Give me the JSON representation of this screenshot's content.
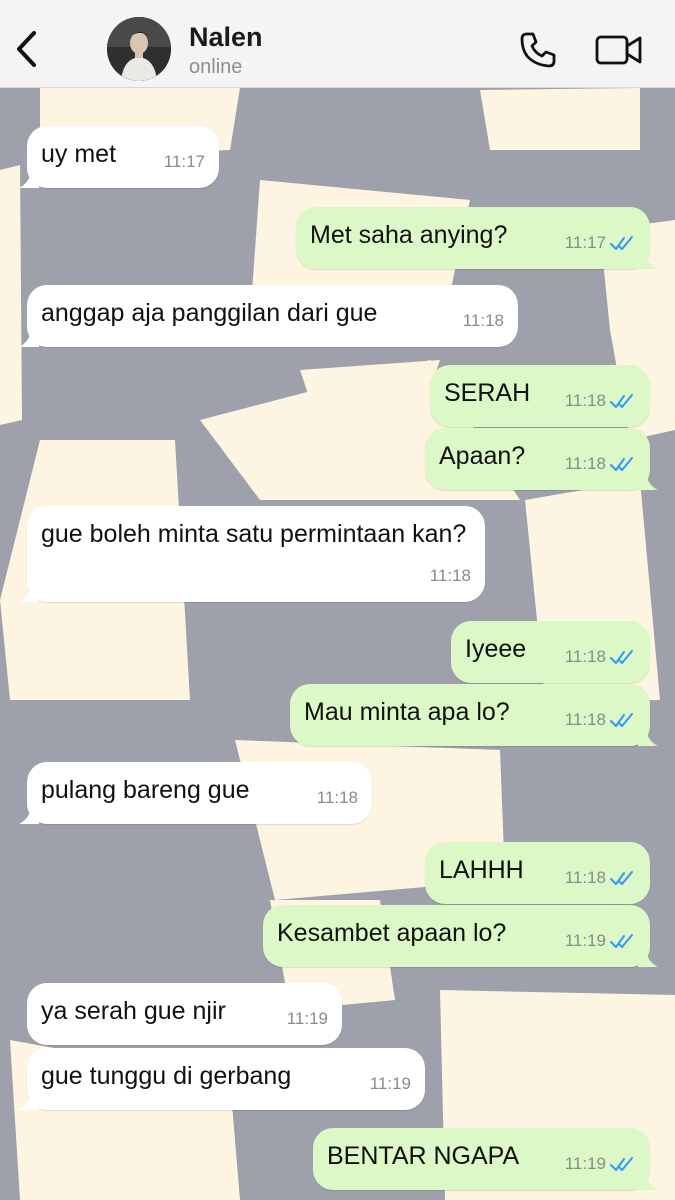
{
  "contact": {
    "name": "Nalen",
    "status": "online"
  },
  "messages": [
    {
      "dir": "in",
      "text": "uy met",
      "time": "11:17"
    },
    {
      "dir": "out",
      "text": "Met saha anying?",
      "time": "11:17"
    },
    {
      "dir": "in",
      "text": "anggap aja panggilan dari gue",
      "time": "11:18"
    },
    {
      "dir": "out",
      "text": "SERAH",
      "time": "11:18"
    },
    {
      "dir": "out",
      "text": "Apaan?",
      "time": "11:18"
    },
    {
      "dir": "in",
      "text": "gue boleh minta satu permintaan kan?",
      "time": "11:18"
    },
    {
      "dir": "out",
      "text": "Iyeee",
      "time": "11:18"
    },
    {
      "dir": "out",
      "text": "Mau minta apa lo?",
      "time": "11:18"
    },
    {
      "dir": "in",
      "text": "pulang bareng gue",
      "time": "11:18"
    },
    {
      "dir": "out",
      "text": "LAHHH",
      "time": "11:18"
    },
    {
      "dir": "out",
      "text": "Kesambet apaan lo?",
      "time": "11:19"
    },
    {
      "dir": "in",
      "text": "ya serah gue njir",
      "time": "11:19"
    },
    {
      "dir": "in",
      "text": "gue tunggu di gerbang",
      "time": "11:19"
    },
    {
      "dir": "out",
      "text": "BENTAR NGAPA",
      "time": "11:19"
    }
  ],
  "colors": {
    "incoming": "#ffffff",
    "outgoing": "#dcf8c6",
    "read_tick": "#3497f9",
    "wallpaper": "#9ea1ab",
    "paper": "#fdf5e1"
  }
}
